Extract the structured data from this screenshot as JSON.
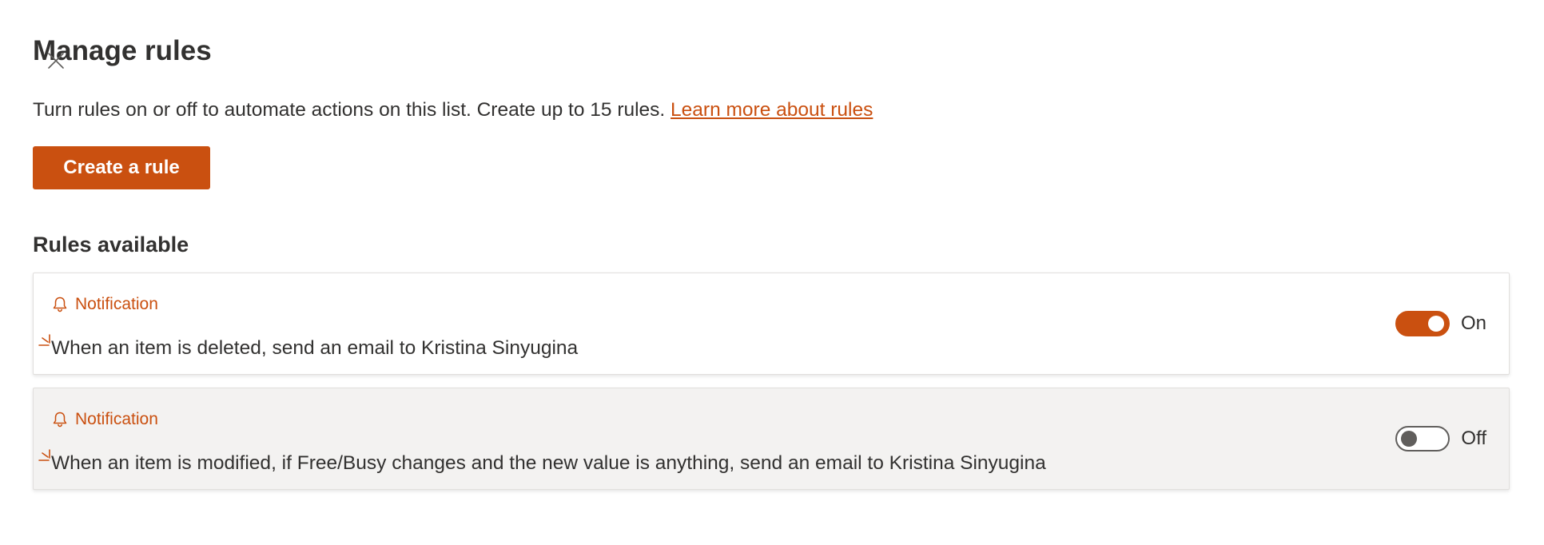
{
  "header": {
    "title": "Manage rules",
    "close_icon": "close-icon"
  },
  "intro": {
    "text": "Turn rules on or off to automate actions on this list. Create up to 15 rules. ",
    "link": "Learn more about rules"
  },
  "actions": {
    "create_label": "Create a rule"
  },
  "rules_section": {
    "title": "Rules available",
    "rules": [
      {
        "type": "Notification",
        "icon": "bell-icon",
        "description": "When an item is deleted, send an email to Kristina Sinyugina",
        "enabled": true,
        "status_label": "On"
      },
      {
        "type": "Notification",
        "icon": "bell-icon",
        "description": "When an item is modified, if Free/Busy changes and the new value is anything, send an email to Kristina Sinyugina",
        "enabled": false,
        "status_label": "Off"
      }
    ]
  },
  "colors": {
    "accent": "#ca5010",
    "text": "#323130",
    "card_alt_bg": "#f3f2f1"
  }
}
